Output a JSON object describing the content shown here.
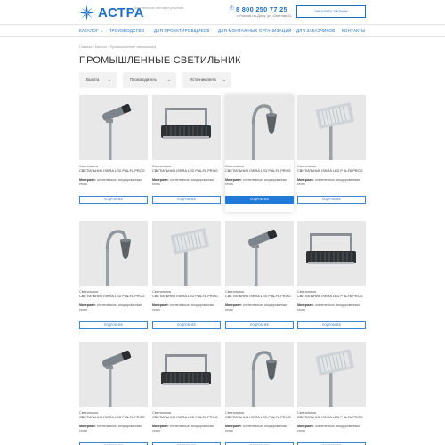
{
  "header": {
    "logo_text": "АСТРА",
    "tagline": "Комплексные световые решения",
    "phone": "8 800 250 77 25",
    "address": "г. Ростов-на-Дону, ул. Светлая 21",
    "callback_label": "ЗАКАЗАТЬ ЗВОНОК"
  },
  "nav": {
    "items": [
      {
        "label": "КАТАЛОГ",
        "dropdown": true
      },
      {
        "label": "ПРОИЗВОДСТВО"
      },
      {
        "label": "ДЛЯ ПРОЕКТИРОВЩИКОВ"
      },
      {
        "label": "ДЛЯ МОНТАЖНЫХ ОРГАНИЗАЦИЙ"
      },
      {
        "label": "ДЛЯ ЗАКАЗЧИКОВ"
      },
      {
        "label": "КОНТАКТЫ"
      }
    ]
  },
  "breadcrumb": "Главная / Каталог / Промышленные светильники",
  "page_title": "ПРОМЫШЛЕННЫЕ СВЕТИЛЬНИК",
  "filters": [
    {
      "label": "Высота"
    },
    {
      "label": "Производитель"
    },
    {
      "label": "Источник света"
    }
  ],
  "product_common": {
    "type": "Светильник",
    "name": "СВЕТИЛЬНИК ISKRA LED P ALFA PROG",
    "material_label": "Материал:",
    "material_value": "оленелезные, анодированные стоек",
    "button_label": "ПОДРОБНЕЕ"
  },
  "products": [
    {
      "image": "spot-on-pole"
    },
    {
      "image": "flood-panel"
    },
    {
      "image": "pendant-on-pole"
    },
    {
      "image": "panel-on-pole"
    },
    {
      "image": "pendant-on-pole"
    },
    {
      "image": "panel-on-pole"
    },
    {
      "image": "spot-on-pole"
    },
    {
      "image": "flood-panel"
    },
    {
      "image": "spot-on-pole"
    },
    {
      "image": "flood-panel"
    },
    {
      "image": "pendant-on-pole"
    },
    {
      "image": "panel-on-pole"
    }
  ],
  "colors": {
    "brand_blue": "#1f6fc4",
    "button_active": "#1f7ad9",
    "thumb_bg": "#e8e8e8"
  },
  "active_product_index": 2
}
